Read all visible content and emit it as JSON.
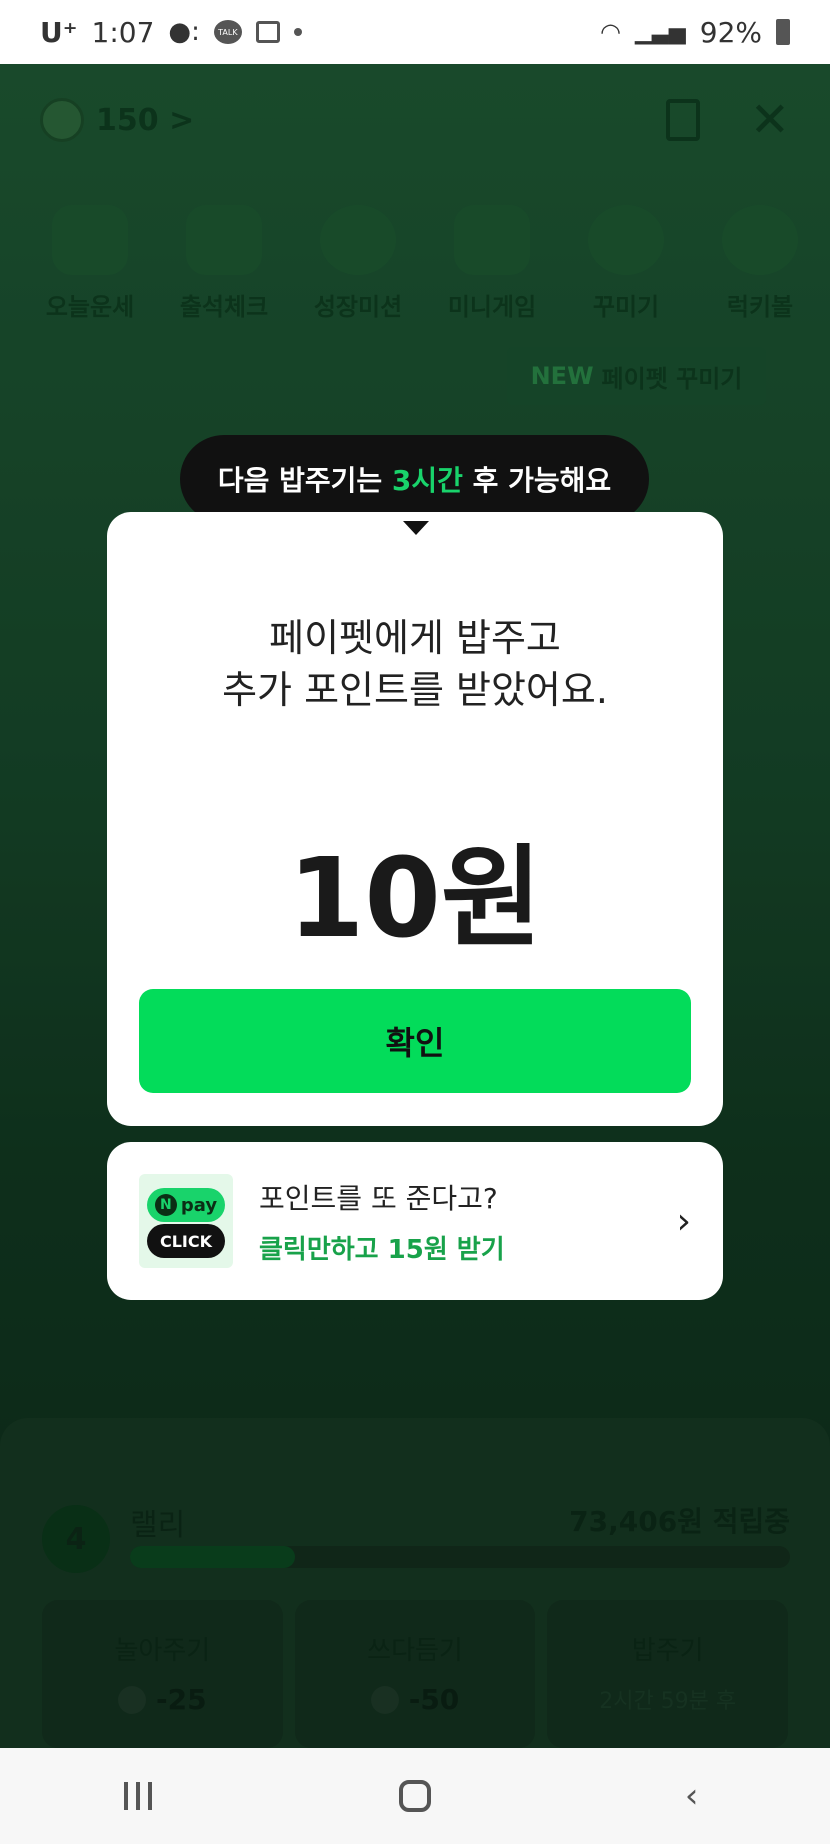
{
  "status_bar": {
    "carrier": "U⁺",
    "time": "1:07",
    "talk_label": "TALK",
    "battery": "92%"
  },
  "background": {
    "points": "150 >",
    "menu": [
      {
        "label": "오늘운세"
      },
      {
        "label": "출석체크"
      },
      {
        "label": "성장미션"
      },
      {
        "label": "미니게임"
      },
      {
        "label": "꾸미기"
      },
      {
        "label": "럭키볼"
      }
    ],
    "new_tooltip": {
      "tag": "NEW",
      "text": "페이펫 꾸미기"
    },
    "pet": {
      "level": "4",
      "name": "랠리",
      "saving": "73,406원 적립중",
      "progress": 0.25
    },
    "actions": [
      {
        "title": "놀아주기",
        "value": "-25"
      },
      {
        "title": "쓰다듬기",
        "value": "-50"
      },
      {
        "title": "밥주기",
        "value": "2시간 59분 후"
      }
    ]
  },
  "bubble": {
    "prefix": "다음 밥주기는 ",
    "highlight": "3시간",
    "suffix": " 후 가능해요"
  },
  "modal": {
    "message_line1": "페이펫에게 밥주고",
    "message_line2": "추가 포인트를 받았어요.",
    "amount": "10원",
    "confirm_label": "확인"
  },
  "promo": {
    "logo_top": "pay",
    "logo_n": "N",
    "logo_bottom": "CLICK",
    "line1": "포인트를 또 준다고?",
    "line2": "클릭만하고 15원 받기",
    "chevron": "›"
  },
  "colors": {
    "accent": "#03dc5a",
    "highlight": "#19d36b",
    "promo_green": "#18a24a"
  }
}
